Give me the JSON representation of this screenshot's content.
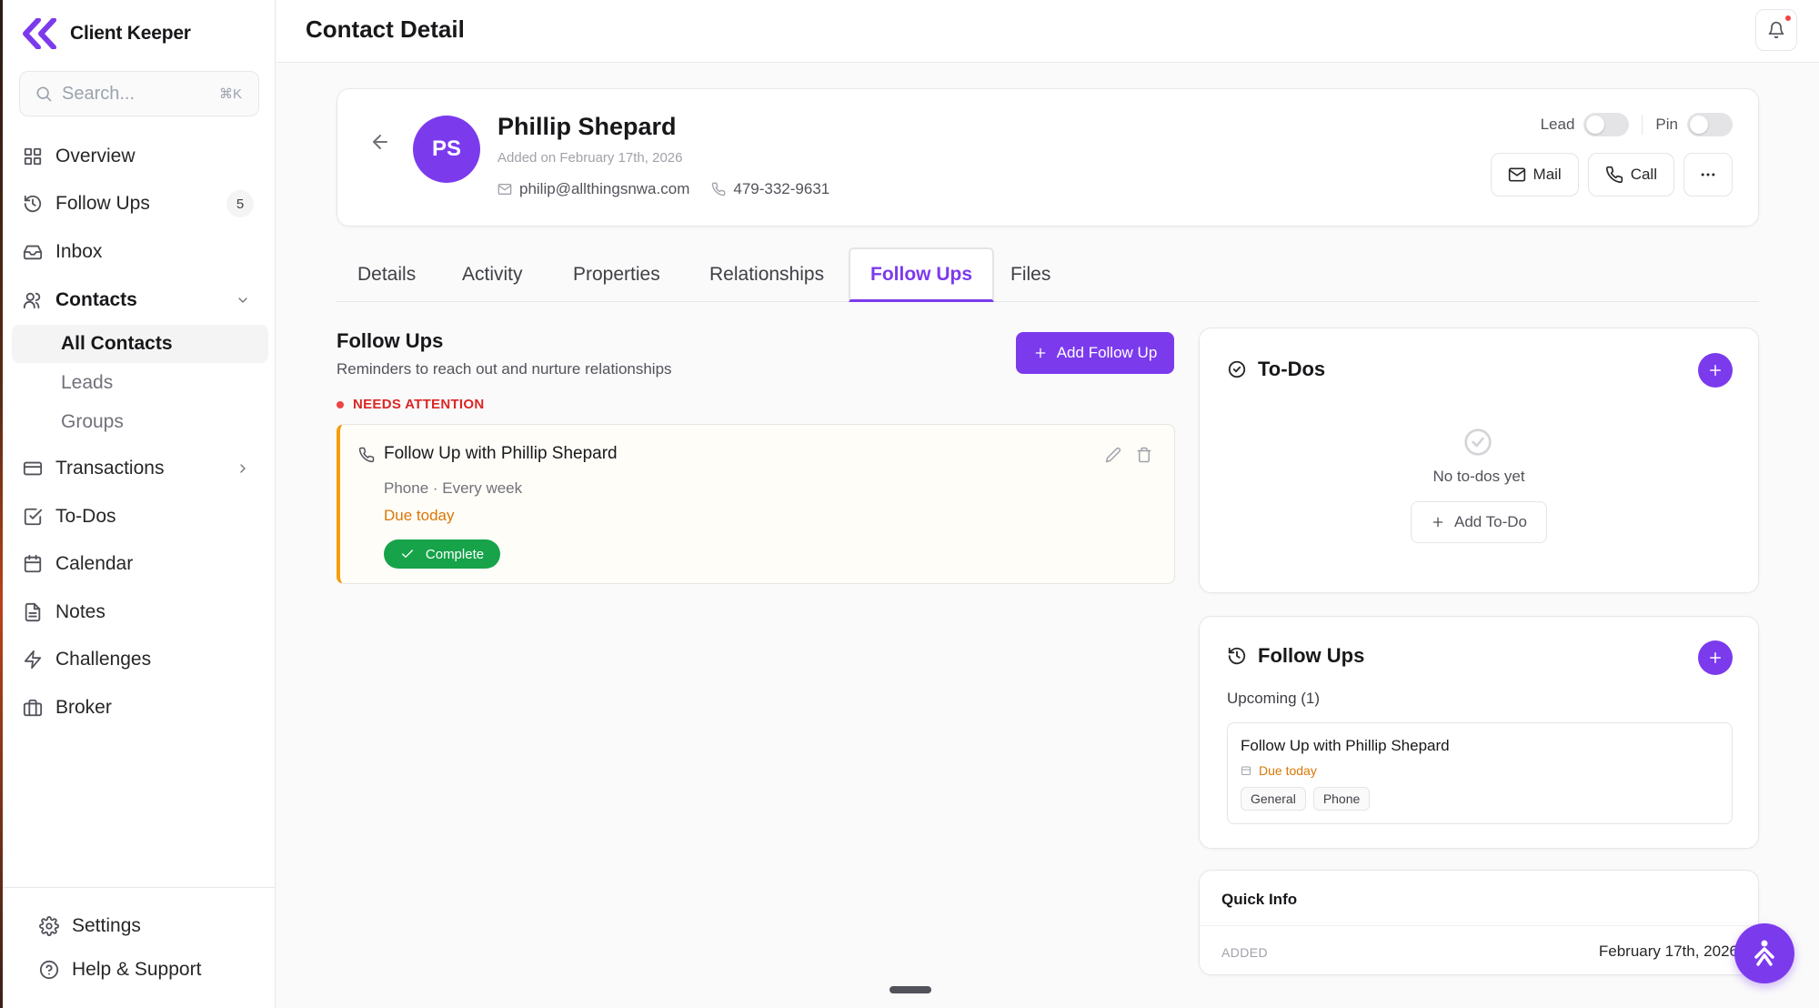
{
  "brand": {
    "name": "Client Keeper",
    "accent": "#7c3aed"
  },
  "search": {
    "placeholder": "Search...",
    "shortcut": "⌘K"
  },
  "sidebar": {
    "items": [
      {
        "label": "Overview",
        "icon": "grid-icon"
      },
      {
        "label": "Follow Ups",
        "icon": "history-icon",
        "badge": "5"
      },
      {
        "label": "Inbox",
        "icon": "inbox-icon"
      },
      {
        "label": "Contacts",
        "icon": "users-icon",
        "expanded": true
      },
      {
        "label": "Transactions",
        "icon": "wallet-icon"
      },
      {
        "label": "To-Dos",
        "icon": "check-square-icon"
      },
      {
        "label": "Calendar",
        "icon": "calendar-icon"
      },
      {
        "label": "Notes",
        "icon": "file-text-icon"
      },
      {
        "label": "Challenges",
        "icon": "zap-icon"
      },
      {
        "label": "Broker",
        "icon": "briefcase-icon"
      }
    ],
    "contacts_sub": [
      {
        "label": "All Contacts",
        "active": true
      },
      {
        "label": "Leads"
      },
      {
        "label": "Groups"
      }
    ],
    "footer": [
      {
        "label": "Settings",
        "icon": "gear-icon"
      },
      {
        "label": "Help & Support",
        "icon": "help-circle-icon"
      }
    ]
  },
  "header": {
    "title": "Contact Detail"
  },
  "contact": {
    "initials": "PS",
    "name": "Phillip Shepard",
    "added_on": "Added on February 17th, 2026",
    "email": "philip@allthingsnwa.com",
    "phone": "479-332-9631",
    "lead_label": "Lead",
    "pin_label": "Pin",
    "lead_on": false,
    "pin_on": false,
    "mail_label": "Mail",
    "call_label": "Call"
  },
  "tabs": [
    {
      "label": "Details"
    },
    {
      "label": "Activity"
    },
    {
      "label": "Properties"
    },
    {
      "label": "Relationships"
    },
    {
      "label": "Follow Ups",
      "active": true
    },
    {
      "label": "Files"
    }
  ],
  "followups": {
    "title": "Follow Ups",
    "subtitle": "Reminders to reach out and nurture relationships",
    "add_label": "Add Follow Up",
    "needs_attention": "NEEDS ATTENTION",
    "card": {
      "title": "Follow Up with Phillip Shepard",
      "meta": "Phone · Every week",
      "due": "Due today",
      "complete_label": "Complete"
    }
  },
  "todos": {
    "title": "To-Dos",
    "empty": "No to-dos yet",
    "add_label": "Add To-Do"
  },
  "side_followups": {
    "title": "Follow Ups",
    "upcoming": "Upcoming (1)",
    "item": {
      "title": "Follow Up with Phillip Shepard",
      "due": "Due today",
      "tags": [
        "General",
        "Phone"
      ]
    }
  },
  "quick_info": {
    "title": "Quick Info",
    "added_label": "ADDED",
    "added_value": "February 17th, 2026"
  },
  "colors": {
    "accent": "#7c3aed",
    "warning": "#d97706",
    "danger": "#dc2626",
    "success": "#16a34a"
  }
}
